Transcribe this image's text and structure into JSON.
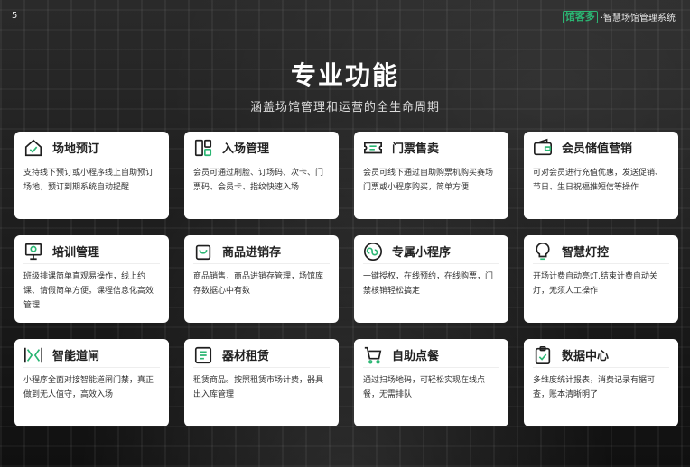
{
  "page_number": "5",
  "brand": {
    "logo": "馆客多",
    "tagline": "·智慧场馆管理系统"
  },
  "title": "专业功能",
  "subtitle": "涵盖场馆管理和运营的全生命周期",
  "colors": {
    "accent": "#2bb673",
    "card_bg": "#ffffff",
    "icon_stroke": "#1f1f1f"
  },
  "cards": [
    {
      "icon": "house-check-icon",
      "title": "场地预订",
      "desc": "支持线下预订或小程序线上自助预订场地，预订到期系统自动提醒"
    },
    {
      "icon": "entrance-icon",
      "title": "入场管理",
      "desc": "会员可通过刷脸、订场码、次卡、门票码、会员卡、指纹快速入场"
    },
    {
      "icon": "ticket-icon",
      "title": "门票售卖",
      "desc": "会员可线下通过自助购票机购买赛场门票或小程序购买，简单方便"
    },
    {
      "icon": "wallet-icon",
      "title": "会员储值营销",
      "desc": "可对会员进行充值优惠，发送促销、节日、生日祝福推短信等操作"
    },
    {
      "icon": "training-board-icon",
      "title": "培训管理",
      "desc": "班级排课简单直观易操作，线上约课、请假简单方便。课程信息化高效管理"
    },
    {
      "icon": "shopping-bag-icon",
      "title": "商品进销存",
      "desc": "商品销售，商品进销存管理，场馆库存数据心中有数"
    },
    {
      "icon": "mini-program-icon",
      "title": "专属小程序",
      "desc": "一键授权，在线预约，在线购票，门禁核销轻松搞定"
    },
    {
      "icon": "light-bulb-icon",
      "title": "智慧灯控",
      "desc": "开场计费自动亮灯,结束计费自动关灯，无须人工操作"
    },
    {
      "icon": "gate-icon",
      "title": "智能道闸",
      "desc": "小程序全面对接智能道闸门禁，真正做到无人值守，高效入场"
    },
    {
      "icon": "rent-icon",
      "title": "器材租赁",
      "desc": "租赁商品。按照租赁市场计费，器具出入库管理"
    },
    {
      "icon": "cart-icon",
      "title": "自助点餐",
      "desc": "通过扫场地码，可轻松实现在线点餐，无需排队"
    },
    {
      "icon": "clipboard-icon",
      "title": "数据中心",
      "desc": "多维度统计报表，消费记录有据可查，账本清晰明了"
    }
  ]
}
